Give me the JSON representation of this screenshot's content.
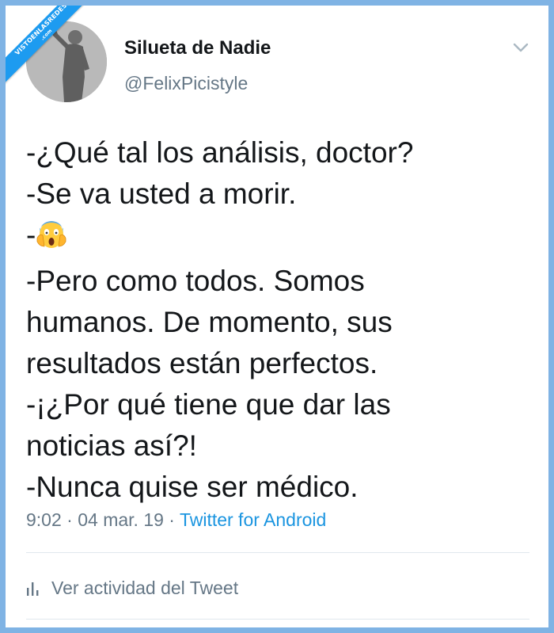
{
  "watermark": {
    "line1": "VISTOENLASREDES",
    "line2": ".com"
  },
  "header": {
    "display_name": "Silueta de Nadie",
    "handle": "@FelixPicistyle"
  },
  "tweet": {
    "lines": [
      "-¿Qué tal los análisis, doctor?",
      "-Se va usted a morir.",
      "-",
      "-Pero como todos. Somos",
      "humanos. De momento, sus",
      "resultados están perfectos.",
      "-¡¿Por qué tiene que dar las",
      "noticias así?!",
      "-Nunca quise ser médico."
    ],
    "emoji": "face-screaming-in-fear-icon"
  },
  "meta": {
    "time": "9:02",
    "separator1": " · ",
    "date": "04 mar. 19",
    "separator2": " · ",
    "source": "Twitter for Android"
  },
  "activity": {
    "label": "Ver actividad del Tweet",
    "icon": "bar-chart-icon"
  },
  "colors": {
    "background_border": "#7fb3e4",
    "link": "#1b95e0",
    "text": "#14171a",
    "muted": "#657786"
  }
}
